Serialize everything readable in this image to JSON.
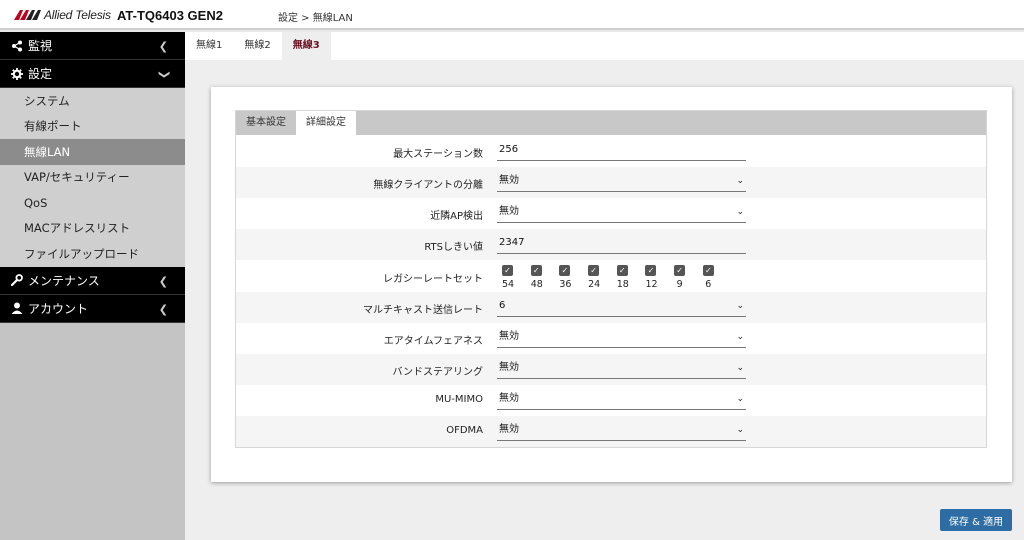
{
  "header": {
    "logo_text": "Allied Telesis",
    "product": "AT-TQ6403 GEN2",
    "breadcrumb": "設定 > 無線LAN"
  },
  "sidebar": {
    "groups": [
      {
        "label": "監視",
        "icon": "share-icon",
        "expanded": false
      },
      {
        "label": "設定",
        "icon": "gear-icon",
        "expanded": true,
        "items": [
          "システム",
          "有線ポート",
          "無線LAN",
          "VAP/セキュリティー",
          "QoS",
          "MACアドレスリスト",
          "ファイルアップロード"
        ],
        "active_item": "無線LAN"
      },
      {
        "label": "メンテナンス",
        "icon": "wrench-icon",
        "expanded": false
      },
      {
        "label": "アカウント",
        "icon": "user-icon",
        "expanded": false
      }
    ]
  },
  "radio_tabs": [
    "無線1",
    "無線2",
    "無線3"
  ],
  "active_radio_tab": "無線3",
  "settings_tabs": [
    "基本設定",
    "詳細設定"
  ],
  "active_settings_tab": "詳細設定",
  "form": {
    "max_stations": {
      "label": "最大ステーション数",
      "value": "256"
    },
    "client_isolation": {
      "label": "無線クライアントの分離",
      "value": "無効"
    },
    "neighbor_ap": {
      "label": "近隣AP検出",
      "value": "無効"
    },
    "rts_threshold": {
      "label": "RTSしきい値",
      "value": "2347"
    },
    "legacy_rates": {
      "label": "レガシーレートセット",
      "rates": [
        "54",
        "48",
        "36",
        "24",
        "18",
        "12",
        "9",
        "6"
      ],
      "checked": [
        true,
        true,
        true,
        true,
        true,
        true,
        true,
        true
      ]
    },
    "multicast_rate": {
      "label": "マルチキャスト送信レート",
      "value": "6"
    },
    "airtime_fairness": {
      "label": "エアタイムフェアネス",
      "value": "無効"
    },
    "band_steering": {
      "label": "バンドステアリング",
      "value": "無効"
    },
    "mu_mimo": {
      "label": "MU-MIMO",
      "value": "無効"
    },
    "ofdma": {
      "label": "OFDMA",
      "value": "無効"
    }
  },
  "save_button": "保存 & 適用",
  "colors": {
    "accent": "#6b1020",
    "button": "#2e6da4",
    "nav_bg": "#000000",
    "sidebar_bg": "#c4c4c4"
  }
}
